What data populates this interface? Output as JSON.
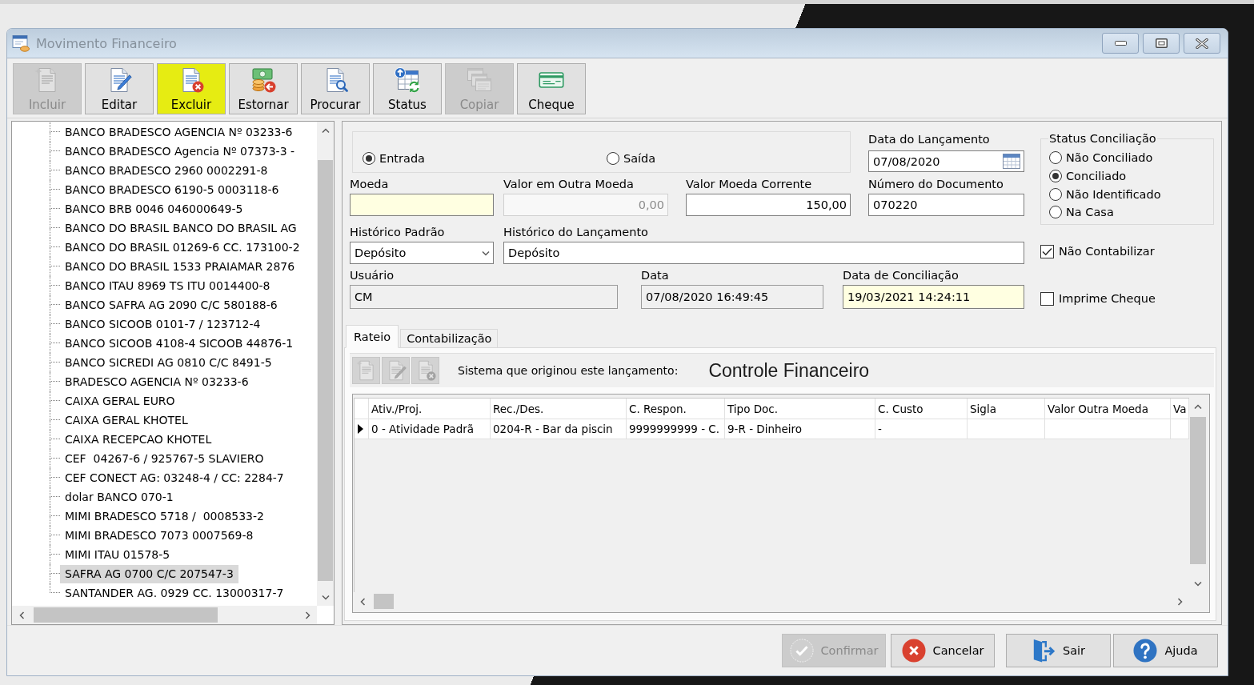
{
  "window": {
    "title": "Movimento Financeiro"
  },
  "toolbar": [
    {
      "label": "Incluir",
      "disabled": true,
      "highlighted": false
    },
    {
      "label": "Editar",
      "disabled": false,
      "highlighted": false
    },
    {
      "label": "Excluir",
      "disabled": false,
      "highlighted": true
    },
    {
      "label": "Estornar",
      "disabled": false,
      "highlighted": false
    },
    {
      "label": "Procurar",
      "disabled": false,
      "highlighted": false
    },
    {
      "label": "Status",
      "disabled": false,
      "highlighted": false
    },
    {
      "label": "Copiar",
      "disabled": true,
      "highlighted": false
    },
    {
      "label": "Cheque",
      "disabled": false,
      "highlighted": false
    }
  ],
  "accounts": [
    {
      "label": "BANCO BRADESCO AGENCIA Nº 03233-6",
      "selected": false
    },
    {
      "label": "BANCO BRADESCO Agencia Nº 07373-3 -",
      "selected": false
    },
    {
      "label": "BANCO BRADESCO 2960 0002291-8",
      "selected": false
    },
    {
      "label": "BANCO BRADESCO 6190-5 0003118-6",
      "selected": false
    },
    {
      "label": "BANCO BRB 0046 046000649-5",
      "selected": false
    },
    {
      "label": "BANCO DO BRASIL BANCO DO BRASIL AG",
      "selected": false
    },
    {
      "label": "BANCO DO BRASIL 01269-6 CC. 173100-2",
      "selected": false
    },
    {
      "label": "BANCO DO BRASIL 1533 PRAIAMAR 2876",
      "selected": false
    },
    {
      "label": "BANCO ITAU 8969 TS ITU 0014400-8",
      "selected": false
    },
    {
      "label": "BANCO SAFRA AG 2090 C/C 580188-6",
      "selected": false
    },
    {
      "label": "BANCO SICOOB 0101-7 / 123712-4",
      "selected": false
    },
    {
      "label": "BANCO SICOOB 4108-4 SICOOB 44876-1",
      "selected": false
    },
    {
      "label": "BANCO SICREDI AG 0810 C/C 8491-5",
      "selected": false
    },
    {
      "label": "BRADESCO AGENCIA Nº 03233-6",
      "selected": false
    },
    {
      "label": "CAIXA GERAL EURO",
      "selected": false
    },
    {
      "label": "CAIXA GERAL KHOTEL",
      "selected": false
    },
    {
      "label": "CAIXA RECEPCAO KHOTEL",
      "selected": false
    },
    {
      "label": "CEF  04267-6 / 925767-5 SLAVIERO",
      "selected": false
    },
    {
      "label": "CEF CONECT AG: 03248-4 / CC: 2284-7",
      "selected": false
    },
    {
      "label": "dolar BANCO 070-1",
      "selected": false
    },
    {
      "label": "MIMI BRADESCO 5718 /  0008533-2",
      "selected": false
    },
    {
      "label": "MIMI BRADESCO 7073 0007569-8",
      "selected": false
    },
    {
      "label": "MIMI ITAU 01578-5",
      "selected": false
    },
    {
      "label": "SAFRA AG 0700 C/C 207547-3",
      "selected": true
    },
    {
      "label": "SANTANDER AG. 0929 CC. 13000317-7",
      "selected": false
    }
  ],
  "entry_type": [
    {
      "label": "Entrada",
      "selected": true
    },
    {
      "label": "Saída",
      "selected": false
    }
  ],
  "fields": [
    {
      "label": "Data do Lançamento",
      "value": "07/08/2020",
      "kind": "date",
      "highlighted": false,
      "readonly": false,
      "disabled": false
    },
    {
      "label": "Moeda",
      "kind": "text",
      "highlighted": true,
      "readonly": false,
      "disabled": false
    },
    {
      "label": "Valor em Outra Moeda",
      "value": "0,00",
      "kind": "number",
      "highlighted": false,
      "readonly": false,
      "disabled": true
    },
    {
      "label": "Valor Moeda Corrente",
      "value": "150,00",
      "kind": "number",
      "highlighted": false,
      "readonly": false,
      "disabled": false
    },
    {
      "label": "Número do Documento",
      "value": "070220",
      "kind": "text",
      "highlighted": false,
      "readonly": false,
      "disabled": false
    },
    {
      "label": "Histórico Padrão",
      "value": "Depósito",
      "kind": "select",
      "highlighted": false,
      "readonly": false,
      "disabled": false
    },
    {
      "label": "Histórico do Lançamento",
      "value": "Depósito",
      "kind": "text",
      "highlighted": false,
      "readonly": false,
      "disabled": false
    },
    {
      "label": "Usuário",
      "value": "CM",
      "kind": "text",
      "highlighted": false,
      "readonly": true,
      "disabled": false
    },
    {
      "label": "Data",
      "value": "07/08/2020 16:49:45",
      "kind": "text",
      "highlighted": false,
      "readonly": true,
      "disabled": false
    },
    {
      "label": "Data de Conciliação",
      "value": "19/03/2021 14:24:11",
      "kind": "text",
      "highlighted": true,
      "readonly": false,
      "disabled": false
    }
  ],
  "status_conciliacao": {
    "title": "Status Conciliação",
    "options": [
      {
        "label": "Não Conciliado",
        "selected": false
      },
      {
        "label": "Conciliado",
        "selected": true
      },
      {
        "label": "Não Identificado",
        "selected": false
      },
      {
        "label": "Na Casa",
        "selected": false
      }
    ]
  },
  "checkboxes": [
    {
      "label": "Não Contabilizar",
      "checked": true
    },
    {
      "label": "Imprime Cheque",
      "checked": false
    }
  ],
  "tabs": [
    {
      "label": "Rateio",
      "selected": true
    },
    {
      "label": "Contabilização",
      "selected": false
    }
  ],
  "rateio": {
    "tool_buttons": [
      {
        "disabled": true
      },
      {
        "disabled": true
      },
      {
        "disabled": true
      }
    ],
    "origin_label": "Sistema que originou este lançamento:",
    "origin_value": "Controle Financeiro",
    "table": {
      "columns": [
        "Ativ./Proj.",
        "Rec./Des.",
        "C. Respon.",
        "Tipo Doc.",
        "C. Custo",
        "Sigla",
        "Valor Outra Moeda",
        "Va"
      ],
      "rows": [
        {
          "selected": true,
          "cells": [
            "0 - Atividade Padrã",
            "0204-R - Bar da piscin",
            "9999999999 - C.",
            "9-R - Dinheiro",
            "-"
          ]
        }
      ]
    }
  },
  "footer_buttons": [
    {
      "label": "Confirmar",
      "disabled": true
    },
    {
      "label": "Cancelar",
      "disabled": false
    },
    {
      "label": "Sair",
      "disabled": false
    },
    {
      "label": "Ajuda",
      "disabled": false
    }
  ]
}
